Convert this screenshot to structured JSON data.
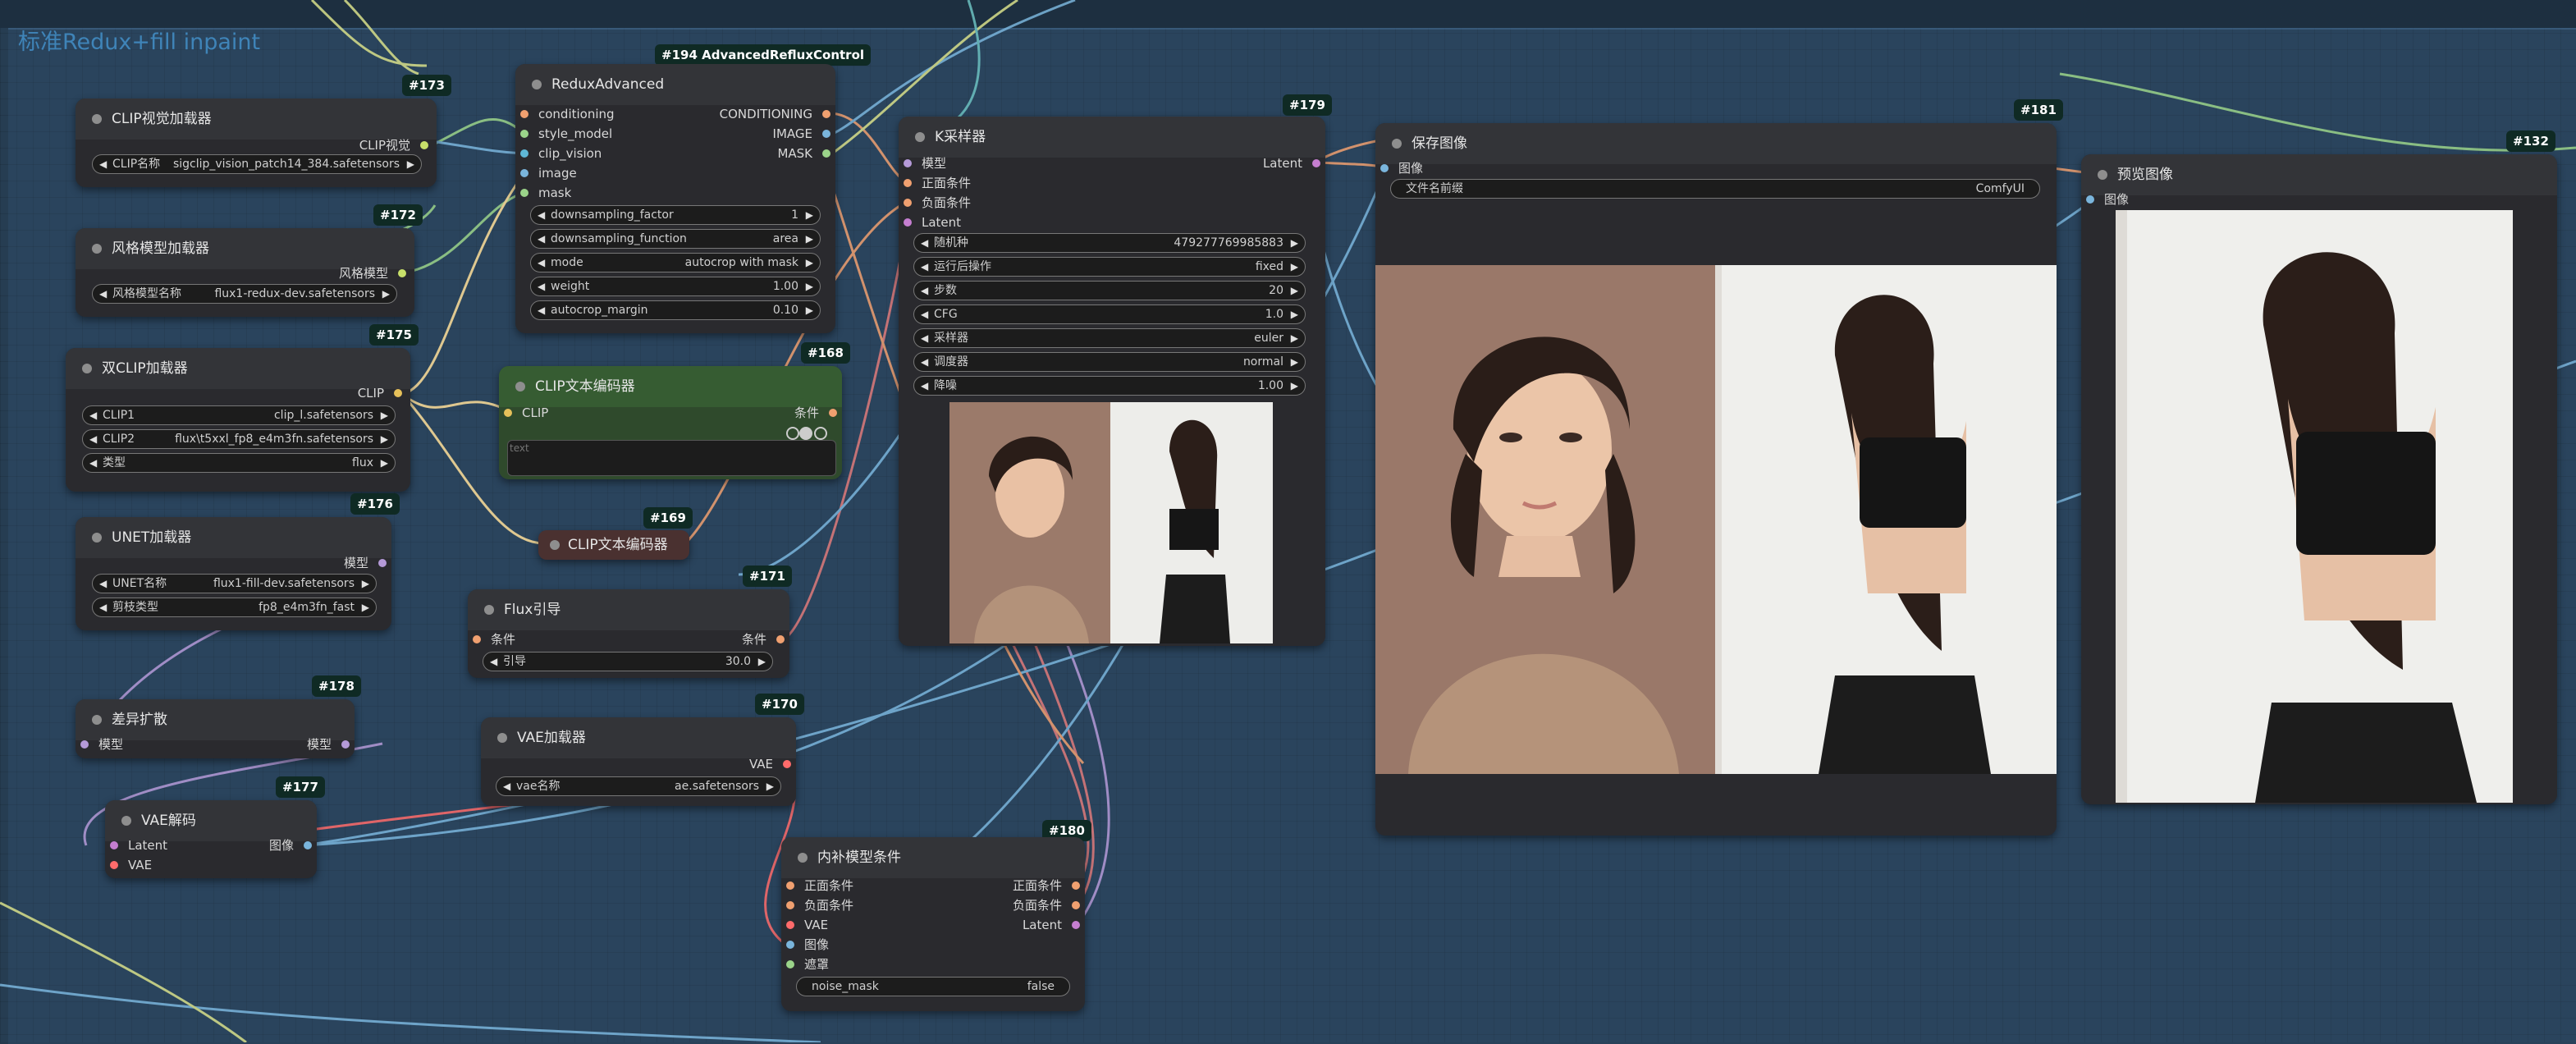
{
  "group": {
    "title": "标准Redux+fill inpaint"
  },
  "nodes": {
    "n173": {
      "id": "#173",
      "title": "CLIP视觉加载器",
      "outputs": [
        "CLIP视觉"
      ],
      "widgets": [
        {
          "label": "CLIP名称",
          "value": "sigclip_vision_patch14_384.safetensors"
        }
      ]
    },
    "n172": {
      "id": "#172",
      "title": "风格模型加载器",
      "outputs": [
        "风格模型"
      ],
      "widgets": [
        {
          "label": "风格模型名称",
          "value": "flux1-redux-dev.safetensors"
        }
      ]
    },
    "n175": {
      "id": "#175",
      "title": "双CLIP加载器",
      "outputs": [
        "CLIP"
      ],
      "widgets": [
        {
          "label": "CLIP1",
          "value": "clip_l.safetensors"
        },
        {
          "label": "CLIP2",
          "value": "flux\\t5xxl_fp8_e4m3fn.safetensors"
        },
        {
          "label": "类型",
          "value": "flux"
        }
      ]
    },
    "n176": {
      "id": "#176",
      "title": "UNET加载器",
      "outputs": [
        "模型"
      ],
      "widgets": [
        {
          "label": "UNET名称",
          "value": "flux1-fill-dev.safetensors"
        },
        {
          "label": "剪枝类型",
          "value": "fp8_e4m3fn_fast"
        }
      ]
    },
    "n178": {
      "id": "#178",
      "title": "差异扩散",
      "inputs": [
        "模型"
      ],
      "outputs": [
        "模型"
      ]
    },
    "n177": {
      "id": "#177",
      "title": "VAE解码",
      "inputs": [
        "Latent",
        "VAE"
      ],
      "outputs": [
        "图像"
      ]
    },
    "n194": {
      "id": "#194 AdvancedRefluxControl",
      "title": "ReduxAdvanced",
      "inputs": [
        "conditioning",
        "style_model",
        "clip_vision",
        "image",
        "mask"
      ],
      "outputs": [
        "CONDITIONING",
        "IMAGE",
        "MASK"
      ],
      "widgets": [
        {
          "label": "downsampling_factor",
          "value": "1"
        },
        {
          "label": "downsampling_function",
          "value": "area"
        },
        {
          "label": "mode",
          "value": "autocrop with mask"
        },
        {
          "label": "weight",
          "value": "1.00"
        },
        {
          "label": "autocrop_margin",
          "value": "0.10"
        }
      ]
    },
    "n168": {
      "id": "#168",
      "title": "CLIP文本编码器",
      "inputs": [
        "CLIP"
      ],
      "outputs": [
        "条件"
      ],
      "placeholder": "text"
    },
    "n169": {
      "id": "#169",
      "title": "CLIP文本编码器"
    },
    "n171": {
      "id": "#171",
      "title": "Flux引导",
      "inputs": [
        "条件"
      ],
      "outputs": [
        "条件"
      ],
      "widgets": [
        {
          "label": "引导",
          "value": "30.0"
        }
      ]
    },
    "n170": {
      "id": "#170",
      "title": "VAE加载器",
      "outputs": [
        "VAE"
      ],
      "widgets": [
        {
          "label": "vae名称",
          "value": "ae.safetensors"
        }
      ]
    },
    "n180": {
      "id": "#180",
      "title": "内补模型条件",
      "inputs": [
        "正面条件",
        "负面条件",
        "VAE",
        "图像",
        "遮罩"
      ],
      "outputs": [
        "正面条件",
        "负面条件",
        "Latent"
      ],
      "widgets": [
        {
          "label": "noise_mask",
          "value": "false"
        }
      ]
    },
    "n179": {
      "id": "#179",
      "title": "K采样器",
      "inputs": [
        "模型",
        "正面条件",
        "负面条件",
        "Latent"
      ],
      "outputs": [
        "Latent"
      ],
      "widgets": [
        {
          "label": "随机种",
          "value": "479277769985883"
        },
        {
          "label": "运行后操作",
          "value": "fixed"
        },
        {
          "label": "步数",
          "value": "20"
        },
        {
          "label": "CFG",
          "value": "1.0"
        },
        {
          "label": "采样器",
          "value": "euler"
        },
        {
          "label": "调度器",
          "value": "normal"
        },
        {
          "label": "降噪",
          "value": "1.00"
        }
      ]
    },
    "n181": {
      "id": "#181",
      "title": "保存图像",
      "inputs": [
        "图像"
      ],
      "widgets": [
        {
          "label": "文件名前缀",
          "value": "ComfyUI"
        }
      ]
    },
    "n132": {
      "id": "#132",
      "title": "预览图像",
      "inputs": [
        "图像"
      ]
    }
  },
  "colors": {
    "canvas": "#263d52",
    "node_body": "#2a2a2e",
    "node_title": "#333438",
    "clip_node_body": "#2f4a2c",
    "clip_node_title": "#365c32",
    "badge": "#0f2a24"
  }
}
